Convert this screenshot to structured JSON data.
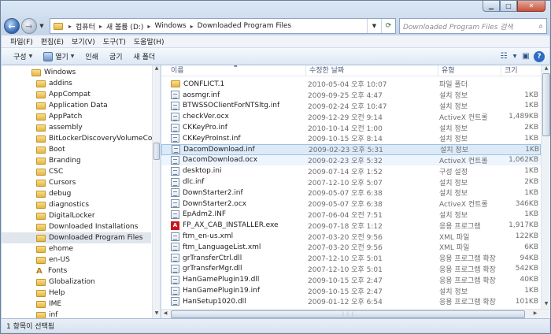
{
  "address": {
    "crumbs": [
      "컴퓨터",
      "새 볼륨 (D:)",
      "Windows",
      "Downloaded Program Files"
    ]
  },
  "search": {
    "placeholder": "Downloaded Program Files 검색"
  },
  "menu": [
    "파일(F)",
    "편집(E)",
    "보기(V)",
    "도구(T)",
    "도움말(H)"
  ],
  "commands": {
    "organize": "구성",
    "open": "열기",
    "print": "인쇄",
    "burn": "굽기",
    "new_folder": "새 폴더"
  },
  "nav_tree": [
    {
      "label": "Windows",
      "level": 0
    },
    {
      "label": "addins",
      "level": 1
    },
    {
      "label": "AppCompat",
      "level": 1
    },
    {
      "label": "Application Data",
      "level": 1
    },
    {
      "label": "AppPatch",
      "level": 1
    },
    {
      "label": "assembly",
      "level": 1
    },
    {
      "label": "BitLockerDiscoveryVolumeContents",
      "level": 1
    },
    {
      "label": "Boot",
      "level": 1
    },
    {
      "label": "Branding",
      "level": 1
    },
    {
      "label": "CSC",
      "level": 1
    },
    {
      "label": "Cursors",
      "level": 1
    },
    {
      "label": "debug",
      "level": 1
    },
    {
      "label": "diagnostics",
      "level": 1
    },
    {
      "label": "DigitalLocker",
      "level": 1
    },
    {
      "label": "Downloaded Installations",
      "level": 1
    },
    {
      "label": "Downloaded Program Files",
      "level": 1,
      "selected": true
    },
    {
      "label": "ehome",
      "level": 1
    },
    {
      "label": "en-US",
      "level": 1
    },
    {
      "label": "Fonts",
      "level": 1,
      "icon": "font"
    },
    {
      "label": "Globalization",
      "level": 1
    },
    {
      "label": "Help",
      "level": 1
    },
    {
      "label": "IME",
      "level": 1
    },
    {
      "label": "inf",
      "level": 1
    }
  ],
  "columns": {
    "name": "이름",
    "date": "수정한 날짜",
    "type": "유형",
    "size": "크기"
  },
  "files": [
    {
      "name": "CONFLICT.1",
      "date": "2010-05-04 오후 10:07",
      "type": "파일 폴더",
      "size": "",
      "icon": "folder"
    },
    {
      "name": "aosmgr.inf",
      "date": "2009-09-25 오후 4:47",
      "type": "설치 정보",
      "size": "1KB",
      "icon": "setup"
    },
    {
      "name": "BTWSSOClientForNTSltg.inf",
      "date": "2009-02-24 오후 10:47",
      "type": "설치 정보",
      "size": "1KB",
      "icon": "setup"
    },
    {
      "name": "checkVer.ocx",
      "date": "2009-12-29 오전 9:14",
      "type": "ActiveX 컨트롤",
      "size": "1,489KB",
      "icon": "setup"
    },
    {
      "name": "CKKeyPro.inf",
      "date": "2010-10-14 오전 1:00",
      "type": "설치 정보",
      "size": "2KB",
      "icon": "setup"
    },
    {
      "name": "CKKeyProInst.inf",
      "date": "2009-10-15 오후 8:14",
      "type": "설치 정보",
      "size": "1KB",
      "icon": "setup"
    },
    {
      "name": "DacomDownload.inf",
      "date": "2009-02-23 오후 5:31",
      "type": "설치 정보",
      "size": "1KB",
      "icon": "setup",
      "state": "selected"
    },
    {
      "name": "DacomDownload.ocx",
      "date": "2009-02-23 오후 5:32",
      "type": "ActiveX 컨트롤",
      "size": "1,062KB",
      "icon": "setup",
      "state": "hover"
    },
    {
      "name": "desktop.ini",
      "date": "2009-07-14 오후 1:52",
      "type": "구성 설정",
      "size": "1KB",
      "icon": "setup"
    },
    {
      "name": "dlc.inf",
      "date": "2007-12-10 오후 5:07",
      "type": "설치 정보",
      "size": "2KB",
      "icon": "setup"
    },
    {
      "name": "DownStarter2.inf",
      "date": "2009-05-07 오후 6:38",
      "type": "설치 정보",
      "size": "1KB",
      "icon": "setup"
    },
    {
      "name": "DownStarter2.ocx",
      "date": "2009-05-07 오후 6:38",
      "type": "ActiveX 컨트롤",
      "size": "346KB",
      "icon": "setup"
    },
    {
      "name": "EpAdm2.INF",
      "date": "2007-06-04 오전 7:51",
      "type": "설치 정보",
      "size": "1KB",
      "icon": "setup"
    },
    {
      "name": "FP_AX_CAB_INSTALLER.exe",
      "date": "2009-07-18 오후 1:12",
      "type": "응용 프로그램",
      "size": "1,917KB",
      "icon": "pdf"
    },
    {
      "name": "ftm_en-us.xml",
      "date": "2007-03-20 오전 9:56",
      "type": "XML 파일",
      "size": "122KB",
      "icon": "setup"
    },
    {
      "name": "ftm_LanguageList.xml",
      "date": "2007-03-20 오전 9:56",
      "type": "XML 파일",
      "size": "6KB",
      "icon": "setup"
    },
    {
      "name": "grTransferCtrl.dll",
      "date": "2007-12-10 오후 5:01",
      "type": "응용 프로그램 확장",
      "size": "94KB",
      "icon": "setup"
    },
    {
      "name": "grTransferMgr.dll",
      "date": "2007-12-10 오후 5:01",
      "type": "응용 프로그램 확장",
      "size": "542KB",
      "icon": "setup"
    },
    {
      "name": "HanGamePlugin19.dll",
      "date": "2009-10-15 오후 2:47",
      "type": "응용 프로그램 확장",
      "size": "40KB",
      "icon": "setup"
    },
    {
      "name": "HanGamePlugin19.inf",
      "date": "2009-10-15 오후 2:47",
      "type": "설치 정보",
      "size": "1KB",
      "icon": "setup"
    },
    {
      "name": "HanSetup1020.dll",
      "date": "2009-01-12 오후 6:54",
      "type": "응용 프로그램 확장",
      "size": "101KB",
      "icon": "setup"
    }
  ],
  "status": {
    "text": "1 항목이 선택됨"
  }
}
